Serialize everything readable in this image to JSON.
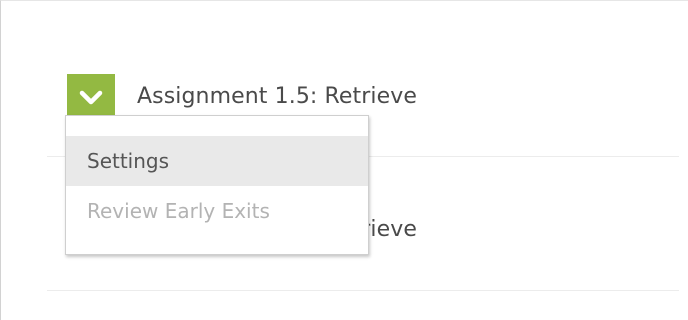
{
  "assignments": [
    {
      "title": "Assignment 1.5: Retrieve"
    },
    {
      "title": "Assignment 1.5: Retrieve"
    }
  ],
  "dropdown": {
    "items": [
      {
        "label": "Settings",
        "state": "highlighted"
      },
      {
        "label": "Review Early Exits",
        "state": "disabled"
      }
    ]
  },
  "colors": {
    "toggle_background": "#93b942",
    "highlight_background": "#e9e9e9",
    "disabled_text": "#b3b3b3"
  },
  "icons": {
    "toggle": "chevron-down-icon"
  }
}
